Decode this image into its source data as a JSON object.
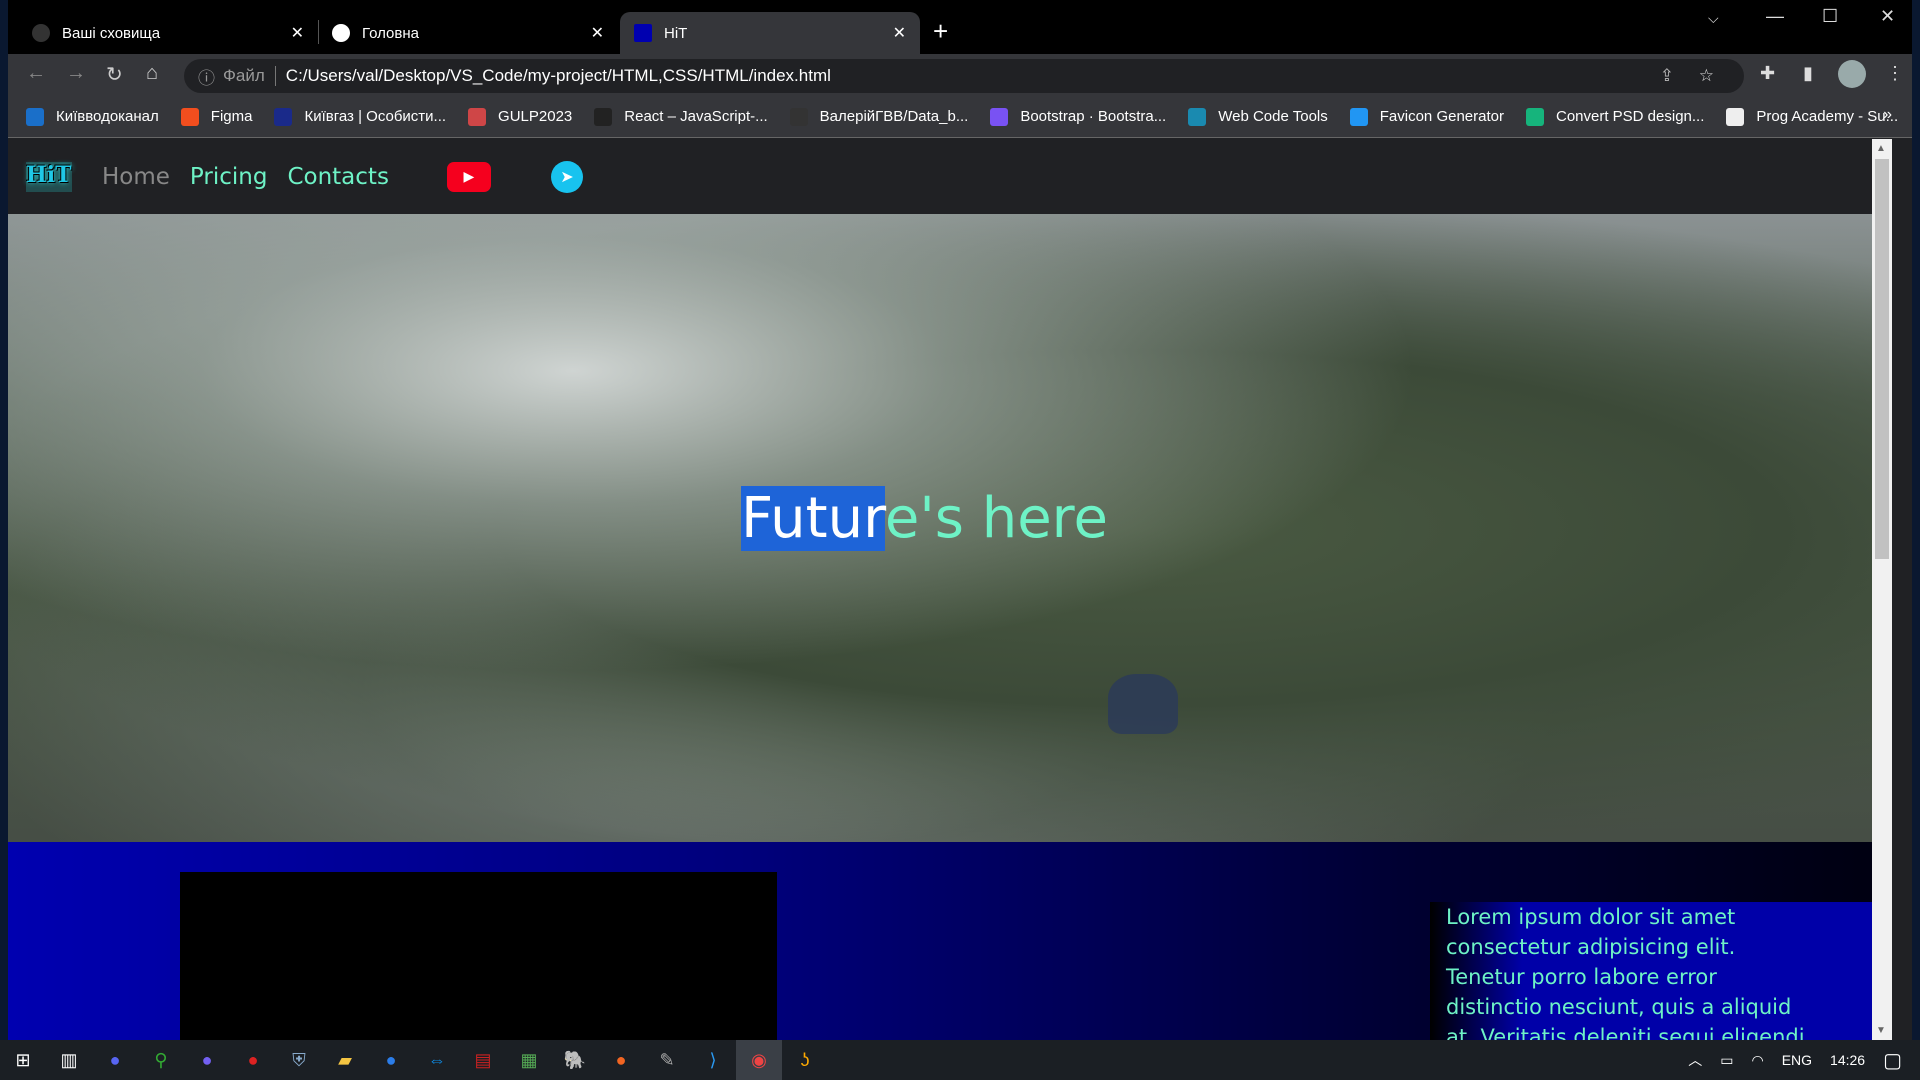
{
  "browser": {
    "tabs": [
      {
        "title": "Ваші сховища",
        "icon": "github-icon"
      },
      {
        "title": "Головна",
        "icon": "globe-icon"
      },
      {
        "title": "HiT",
        "icon": "hit-favicon"
      }
    ],
    "file_label": "Файл",
    "url": "C:/Users/val/Desktop/VS_Code/my-project/HTML,CSS/HTML/index.html",
    "bookmarks": [
      {
        "label": "Київводоканал",
        "color": "#1a6fc9"
      },
      {
        "label": "Figma",
        "color": "#f24e1e"
      },
      {
        "label": "Київгаз | Особисти...",
        "color": "#1a2a8a"
      },
      {
        "label": "GULP2023",
        "color": "#cf4647"
      },
      {
        "label": "React – JavaScript-...",
        "color": "#222"
      },
      {
        "label": "ВалерійГВВ/Data_b...",
        "color": "#333"
      },
      {
        "label": "Bootstrap · Bootstra...",
        "color": "#7952f3"
      },
      {
        "label": "Web Code Tools",
        "color": "#1a8ab0"
      },
      {
        "label": "Favicon Generator",
        "color": "#2196f3"
      },
      {
        "label": "Convert PSD design...",
        "color": "#16b47c"
      },
      {
        "label": "Prog Academy  - Su...",
        "color": "#eee"
      }
    ],
    "more_label": "»"
  },
  "site": {
    "logo": "HiT",
    "nav": [
      "Home",
      "Pricing",
      "Contacts"
    ],
    "hero": {
      "selected": "Futur",
      "rest": "e's here"
    },
    "lorem_lines": [
      "Lorem ipsum dolor sit amet",
      "consectetur adipisicing elit.",
      "Tenetur porro labore error",
      "distinctio nesciunt, quis a aliquid",
      "at. Veritatis deleniti sequi eligendi"
    ]
  },
  "taskbar": {
    "lang": "ENG",
    "time": "14:26"
  }
}
